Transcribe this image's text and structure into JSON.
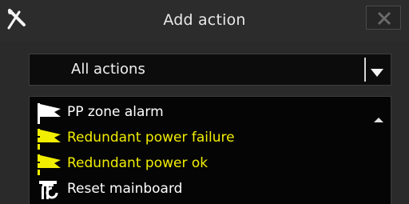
{
  "dialog": {
    "title": "Add action",
    "pin_icon": "pin-icon",
    "close_icon": "close-icon"
  },
  "filter": {
    "selected": "All actions",
    "arrow_icon": "chevron-down-icon"
  },
  "actions": {
    "items": [
      {
        "label": "PP zone alarm",
        "icon": "flag-icon",
        "color": "#ffffff"
      },
      {
        "label": "Redundant power failure",
        "icon": "flag-icon",
        "color": "#f2ee00"
      },
      {
        "label": "Redundant power ok",
        "icon": "flag-icon",
        "color": "#f2ee00"
      },
      {
        "label": "Reset mainboard",
        "icon": "reset-icon",
        "color": "#ffffff"
      }
    ],
    "scroll_icon": "scroll-up-icon"
  },
  "colors": {
    "background": "#2a2a2a",
    "list_background": "#050505",
    "highlight": "#f2ee00",
    "text": "#ffffff"
  }
}
